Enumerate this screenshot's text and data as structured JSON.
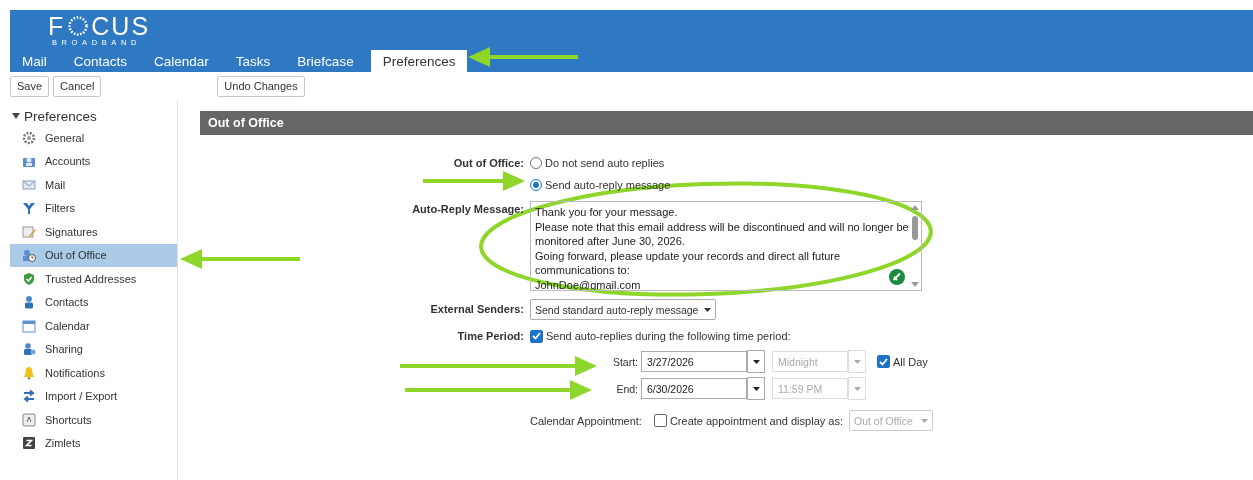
{
  "logo": {
    "before": "F",
    "after": "CUS",
    "tagline": "BROADBAND"
  },
  "tabs": [
    {
      "label": "Mail",
      "selected": false
    },
    {
      "label": "Contacts",
      "selected": false
    },
    {
      "label": "Calendar",
      "selected": false
    },
    {
      "label": "Tasks",
      "selected": false
    },
    {
      "label": "Briefcase",
      "selected": false
    },
    {
      "label": "Preferences",
      "selected": true
    }
  ],
  "toolbar": {
    "buttons": [
      "Save",
      "Cancel"
    ],
    "undo": "Undo Changes"
  },
  "sidebar": {
    "title": "Preferences",
    "expanded": true,
    "items": [
      {
        "label": "General",
        "selected": false
      },
      {
        "label": "Accounts",
        "selected": false
      },
      {
        "label": "Mail",
        "selected": false
      },
      {
        "label": "Filters",
        "selected": false
      },
      {
        "label": "Signatures",
        "selected": false
      },
      {
        "label": "Out of Office",
        "selected": true
      },
      {
        "label": "Trusted Addresses",
        "selected": false
      },
      {
        "label": "Contacts",
        "selected": false
      },
      {
        "label": "Calendar",
        "selected": false
      },
      {
        "label": "Sharing",
        "selected": false
      },
      {
        "label": "Notifications",
        "selected": false
      },
      {
        "label": "Import / Export",
        "selected": false
      },
      {
        "label": "Shortcuts",
        "selected": false
      },
      {
        "label": "Zimlets",
        "selected": false
      }
    ]
  },
  "section_title": "Out of Office",
  "form": {
    "out_of_office": {
      "label": "Out of Office:",
      "options": [
        {
          "label": "Do not send auto replies",
          "selected": false
        },
        {
          "label": "Send auto-reply message",
          "selected": true
        }
      ]
    },
    "auto_reply": {
      "label": "Auto-Reply Message:",
      "lines": [
        "Thank you for your message.",
        "Please note that this email address will be discontinued and will no longer be",
        "monitored after June 30, 2026.",
        "Going forward, please update your records and direct all future",
        "communications to:",
        "JohnDoe@gmail.com"
      ]
    },
    "external_senders": {
      "label": "External Senders:",
      "value": "Send standard auto-reply message"
    },
    "time_period": {
      "label": "Time Period:",
      "checkbox_label": "Send auto-replies during the following time period:",
      "checked": true
    },
    "start": {
      "label": "Start:",
      "date": "3/27/2026",
      "time": "Midnight"
    },
    "end": {
      "label": "End:",
      "date": "6/30/2026",
      "time": "11:59 PM"
    },
    "all_day": {
      "label": "All Day",
      "checked": true
    },
    "calendar_appointment": {
      "label": "Calendar Appointment:",
      "checkbox_label": "Create appointment and display as:",
      "checked": false,
      "show_as": "Out of Office"
    }
  }
}
